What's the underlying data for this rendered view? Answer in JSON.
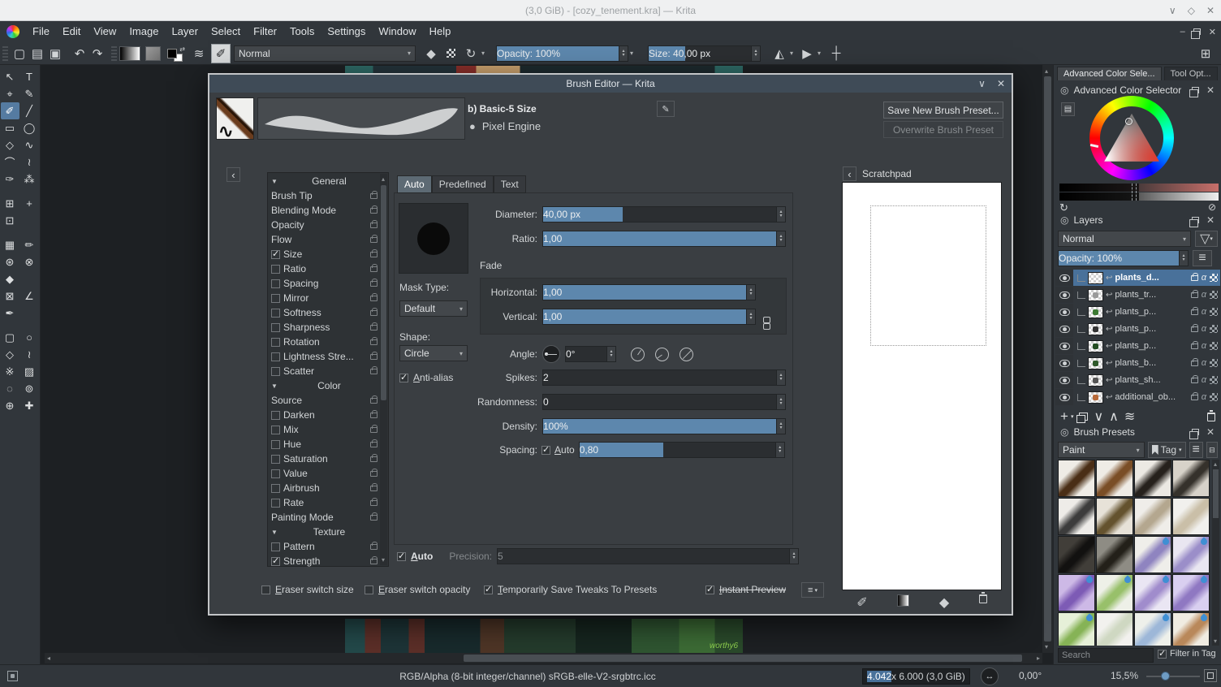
{
  "window": {
    "title": "(3,0 GiB) - [cozy_tenement.kra] — Krita",
    "minimize": "∨",
    "maximize": "◇",
    "close": "✕"
  },
  "menubar": [
    "File",
    "Edit",
    "View",
    "Image",
    "Layer",
    "Select",
    "Filter",
    "Tools",
    "Settings",
    "Window",
    "Help"
  ],
  "toolbar": {
    "blend_mode": "Normal",
    "opacity_label": "Opacity: 100%",
    "opacity_fill": 100,
    "size_label": "Size: 40,00 px",
    "size_fill": 36
  },
  "toolbox": [
    {
      "name": "select-shapes-tool",
      "glyph": "↖"
    },
    {
      "name": "text-tool",
      "glyph": "T"
    },
    {
      "name": "edit-shapes-tool",
      "glyph": "⌖"
    },
    {
      "name": "calligraphy-tool",
      "glyph": "✎"
    },
    {
      "name": "freehand-brush-tool",
      "glyph": "✐",
      "active": true
    },
    {
      "name": "line-tool",
      "glyph": "╱"
    },
    {
      "name": "rectangle-tool",
      "glyph": "▭"
    },
    {
      "name": "ellipse-tool",
      "glyph": "◯"
    },
    {
      "name": "polygon-tool",
      "glyph": "◇"
    },
    {
      "name": "polyline-tool",
      "glyph": "∿"
    },
    {
      "name": "bezier-curve-tool",
      "glyph": "⌒"
    },
    {
      "name": "freehand-path-tool",
      "glyph": "≀"
    },
    {
      "name": "dynamic-brush-tool",
      "glyph": "✑"
    },
    {
      "name": "multibrush-tool",
      "glyph": "⁂"
    },
    {
      "name": "transform-tool",
      "glyph": "⊞",
      "gap": true
    },
    {
      "name": "move-tool",
      "glyph": "+",
      "gap": true
    },
    {
      "name": "crop-tool",
      "glyph": "⊡"
    },
    {
      "name": "",
      "glyph": "",
      "spacer": true
    },
    {
      "name": "gradient-tool",
      "glyph": "▦",
      "gap": true
    },
    {
      "name": "color-sampler-tool",
      "glyph": "✏",
      "gap": true
    },
    {
      "name": "pattern-edit-tool",
      "glyph": "⊛"
    },
    {
      "name": "smart-patch-tool",
      "glyph": "⊗"
    },
    {
      "name": "fill-tool",
      "glyph": "◆"
    },
    {
      "name": "",
      "glyph": "",
      "spacer": true
    },
    {
      "name": "assistants-tool",
      "glyph": "⊠"
    },
    {
      "name": "measure-tool",
      "glyph": "∠"
    },
    {
      "name": "reference-images-tool",
      "glyph": "✒"
    },
    {
      "name": "",
      "glyph": "",
      "spacer": true
    },
    {
      "name": "rectangular-select-tool",
      "glyph": "▢",
      "gap": true
    },
    {
      "name": "elliptical-select-tool",
      "glyph": "○",
      "gap": true
    },
    {
      "name": "polygonal-select-tool",
      "glyph": "◇"
    },
    {
      "name": "freehand-select-tool",
      "glyph": "≀"
    },
    {
      "name": "similar-color-select-tool",
      "glyph": "※"
    },
    {
      "name": "contiguous-select-tool",
      "glyph": "▨"
    },
    {
      "name": "bezier-select-tool",
      "glyph": "◌"
    },
    {
      "name": "magnetic-select-tool",
      "glyph": "⊚"
    },
    {
      "name": "zoom-tool",
      "glyph": "⊕"
    },
    {
      "name": "pan-tool",
      "glyph": "✚"
    }
  ],
  "canvas": {
    "signature": "worthy6"
  },
  "dialog": {
    "title": "Brush Editor — Krita",
    "preset_name": "b) Basic-5 Size",
    "engine": "Pixel Engine",
    "save_new_button": "Save New Brush Preset...",
    "overwrite_button": "Overwrite Brush Preset",
    "tabs": [
      {
        "label": "Auto",
        "active": true
      },
      {
        "label": "Predefined",
        "active": false
      },
      {
        "label": "Text",
        "active": false
      }
    ],
    "options": [
      {
        "label": "General",
        "type": "header"
      },
      {
        "label": "Brush Tip",
        "type": "plain"
      },
      {
        "label": "Blending Mode",
        "type": "plain"
      },
      {
        "label": "Opacity",
        "type": "plain"
      },
      {
        "label": "Flow",
        "type": "plain"
      },
      {
        "label": "Size",
        "type": "check",
        "checked": true
      },
      {
        "label": "Ratio",
        "type": "check",
        "checked": false
      },
      {
        "label": "Spacing",
        "type": "check",
        "checked": false
      },
      {
        "label": "Mirror",
        "type": "check",
        "checked": false
      },
      {
        "label": "Softness",
        "type": "check",
        "checked": false
      },
      {
        "label": "Sharpness",
        "type": "check",
        "checked": false
      },
      {
        "label": "Rotation",
        "type": "check",
        "checked": false
      },
      {
        "label": "Lightness Stre...",
        "type": "check",
        "checked": false
      },
      {
        "label": "Scatter",
        "type": "check",
        "checked": false
      },
      {
        "label": "Color",
        "type": "header"
      },
      {
        "label": "Source",
        "type": "plain"
      },
      {
        "label": "Darken",
        "type": "check",
        "checked": false
      },
      {
        "label": "Mix",
        "type": "check",
        "checked": false
      },
      {
        "label": "Hue",
        "type": "check",
        "checked": false
      },
      {
        "label": "Saturation",
        "type": "check",
        "checked": false
      },
      {
        "label": "Value",
        "type": "check",
        "checked": false
      },
      {
        "label": "Airbrush",
        "type": "check",
        "checked": false
      },
      {
        "label": "Rate",
        "type": "check",
        "checked": false
      },
      {
        "label": "Painting Mode",
        "type": "plain"
      },
      {
        "label": "Texture",
        "type": "header"
      },
      {
        "label": "Pattern",
        "type": "check",
        "checked": false
      },
      {
        "label": "Strength",
        "type": "check",
        "checked": true
      }
    ],
    "settings": {
      "diameter_label": "Diameter:",
      "diameter_value": "40,00 px",
      "diameter_fill": 34,
      "ratio_label": "Ratio:",
      "ratio_value": "1,00",
      "ratio_fill": 100,
      "fade_label": "Fade",
      "mask_type_label": "Mask Type:",
      "mask_type_value": "Default",
      "horizontal_label": "Horizontal:",
      "horizontal_value": "1,00",
      "horizontal_fill": 100,
      "vertical_label": "Vertical:",
      "vertical_value": "1,00",
      "vertical_fill": 100,
      "shape_label": "Shape:",
      "shape_value": "Circle",
      "angle_label": "Angle:",
      "angle_value": "0°",
      "antialias_label": "Anti-alias",
      "spikes_label": "Spikes:",
      "spikes_value": "2",
      "spikes_fill": 0,
      "randomness_label": "Randomness:",
      "randomness_value": "0",
      "randomness_fill": 0,
      "density_label": "Density:",
      "density_value": "100%",
      "density_fill": 100,
      "spacing_label": "Spacing:",
      "spacing_auto": "Auto",
      "spacing_value": "0,80",
      "spacing_fill": 43,
      "auto_label": "Auto",
      "precision_label": "Precision:",
      "precision_value": "5"
    },
    "footer": {
      "eraser_size": "Eraser switch size",
      "eraser_opacity": "Eraser switch opacity",
      "temp_save": "Temporarily Save Tweaks To Presets",
      "instant_preview": "Instant Preview"
    },
    "scratchpad_title": "Scratchpad"
  },
  "right_panel": {
    "tabs": [
      {
        "label": "Advanced Color Sele...",
        "active": true
      },
      {
        "label": "Tool Opt...",
        "active": false
      }
    ],
    "color_selector_title": "Advanced Color Selector",
    "layers": {
      "title": "Layers",
      "blend_mode": "Normal",
      "opacity_label": "Opacity:  100%",
      "opacity_fill": 100,
      "rows": [
        {
          "name": "plants_d...",
          "selected": true,
          "dot": ""
        },
        {
          "name": "plants_tr...",
          "selected": false,
          "dot": "#9a9a9a"
        },
        {
          "name": "plants_p...",
          "selected": false,
          "dot": "#3d7a33"
        },
        {
          "name": "plants_p...",
          "selected": false,
          "dot": "#333333"
        },
        {
          "name": "plants_p...",
          "selected": false,
          "dot": "#244d22"
        },
        {
          "name": "plants_b...",
          "selected": false,
          "dot": "#2f5a2a"
        },
        {
          "name": "plants_sh...",
          "selected": false,
          "dot": "#555555"
        },
        {
          "name": "additional_ob...",
          "selected": false,
          "dot": "#b86a3a"
        }
      ]
    },
    "brush_presets": {
      "title": "Brush Presets",
      "tag_filter": "Paint",
      "tag_button": "Tag",
      "search_placeholder": "Search",
      "filter_in_tag": "Filter in Tag",
      "thumbs": [
        {
          "c1": "#efece6",
          "c2": "#4a2e16",
          "badge": false
        },
        {
          "c1": "#efece6",
          "c2": "#7a4e26",
          "badge": false
        },
        {
          "c1": "#ece9e3",
          "c2": "#26211c",
          "badge": false
        },
        {
          "c1": "#d7d2c9",
          "c2": "#35312b",
          "badge": false
        },
        {
          "c1": "#eeece8",
          "c2": "#3c3c3c",
          "badge": false
        },
        {
          "c1": "#e7e2d8",
          "c2": "#64522e",
          "badge": false
        },
        {
          "c1": "#efede9",
          "c2": "#b4a78f",
          "badge": false
        },
        {
          "c1": "#f1f0ed",
          "c2": "#cabfa8",
          "badge": false
        },
        {
          "c1": "#413e39",
          "c2": "#121110",
          "badge": false
        },
        {
          "c1": "#8e8c84",
          "c2": "#232019",
          "badge": false
        },
        {
          "c1": "#efeeea",
          "c2": "#8f84c0",
          "badge": true
        },
        {
          "c1": "#e9e6f1",
          "c2": "#9b8ec9",
          "badge": true
        },
        {
          "c1": "#cdb9e6",
          "c2": "#7d5bb5",
          "badge": true
        },
        {
          "c1": "#eef0e8",
          "c2": "#98c06a",
          "badge": true
        },
        {
          "c1": "#eae6f3",
          "c2": "#a08ccc",
          "badge": true
        },
        {
          "c1": "#d9cff0",
          "c2": "#8f78c2",
          "badge": true
        },
        {
          "c1": "#e6f0d8",
          "c2": "#86b356",
          "badge": true
        },
        {
          "c1": "#f2f1ee",
          "c2": "#cfd8c2",
          "badge": false
        },
        {
          "c1": "#eef0ea",
          "c2": "#9db7d8",
          "badge": true
        },
        {
          "c1": "#f0ece2",
          "c2": "#b9885a",
          "badge": true
        }
      ]
    }
  },
  "statusbar": {
    "profile": "RGB/Alpha (8-bit integer/channel)  sRGB-elle-V2-srgbtrc.icc",
    "dims_selected": "4.042",
    "dims_rest": " x 6.000 (3,0 GiB)",
    "rotation": "0,00°",
    "zoom": "15,5%"
  },
  "colors": {
    "accent_blue": "#5d87ad",
    "selection_blue": "#49719a"
  }
}
